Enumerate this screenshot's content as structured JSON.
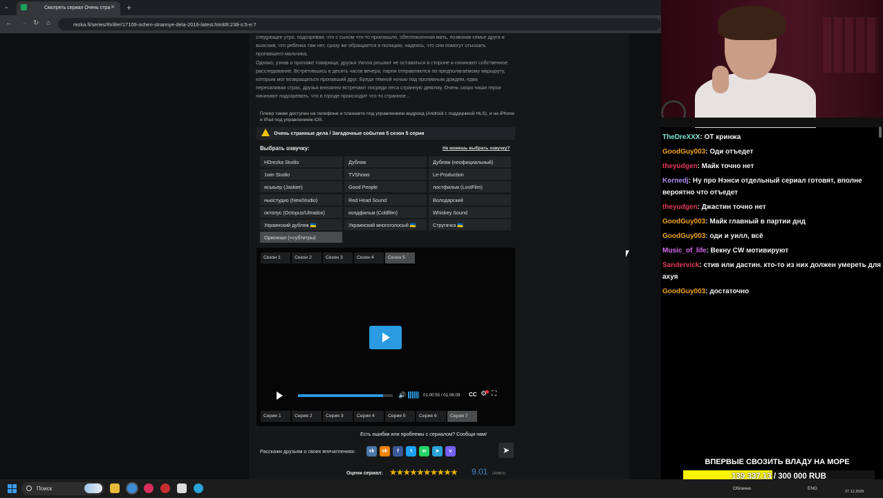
{
  "browser": {
    "tab_title": "Смотреть сериал Очень стра",
    "tab_close": "×",
    "new_tab": "+",
    "tab_menu": "⌄",
    "url": "rezka.fi/series/thriller/17109-ochen-strannye-dela-2016-latest.html#t:238-s:5-e:7",
    "nav_back": "←",
    "nav_forward": "→",
    "nav_reload": "↻",
    "nav_home": "⌂"
  },
  "description": {
    "paragraph1": "следующее утро, подозревая, что с сыном что-то произошло, обеспокоенная мать, позвонив семье друга и выяснив, что ребенка там нет, сразу же обращается в полицию, надеясь, что они помогут отыскать пропавшего мальчика.",
    "paragraph2": "Однако, узнав о пропаже товарища, друзья Уилла решают не оставаться в стороне и начинают собственное расследование. Встретившись в десять часов вечера, парни отправляются по предполагаемому маршруту, которым мог возвращаться пропавший друг. Бредя тёмной ночью под проливным дождем, едва пересиливая страх, друзья внезапно встречают посреди леса странную девочку. Очень скоро наши герои начинают подозревать, что в городе происходит что-то странное..."
  },
  "player_note": "Плеер также доступен на телефоне и планшете под управлением андроид (Android с поддержкой HLS), и на iPhone и iPad под управлением iOS.",
  "episode_title": "Очень странные дела / Загадочные события 5 сезон 5 серия",
  "dubbing": {
    "title": "Выбрать озвучку:",
    "help_link": "Не можешь выбрать озвучку?",
    "options": [
      "HDrezka Studio",
      "Дубляж",
      "Дубляж (неофициальный)",
      "1win Studio",
      "TVShows",
      "Le-Production",
      "яськьер (Jaskier)",
      "Good People",
      "лостфильм (LostFilm)",
      "ньюстудио (NewStudio)",
      "Red Head Sound",
      "Володарский",
      "октопус (Octopus/Ultradox)",
      "колдфильм (Coldfilm)",
      "Whiskey Sound",
      "Украинский дубляж 🇺🇦",
      "Украинский многоголосый 🇺🇦",
      "Стругачка 🇺🇦",
      "Оригинал (+субтитры)"
    ],
    "selected_index": 18
  },
  "seasons": {
    "items": [
      "Сезон 1",
      "Сезон 2",
      "Сезон 3",
      "Сезон 4",
      "Сезон 5"
    ],
    "selected_index": 4
  },
  "player": {
    "time_display": "01:00:55 / 01:06:09",
    "progress_fraction": 0.9,
    "cc_label": "CC",
    "volume_icon": "speaker-icon",
    "volume_symbol": "🔊",
    "settings_symbol": "⚙",
    "fullscreen_symbol": "⛶"
  },
  "episodes": {
    "items": [
      "Серия 1",
      "Серия 2",
      "Серия 3",
      "Серия 4",
      "Серия 5",
      "Серия 6",
      "Серия 7"
    ],
    "selected_index": 6
  },
  "report_text": "Есть ошибки или проблемы с сериалом? Сообщи нам!",
  "share": {
    "label": "Расскажи друзьям о своих впечатлениях:",
    "networks": [
      {
        "name": "vk",
        "glyph": "vk",
        "color": "#4a76a8"
      },
      {
        "name": "ok",
        "glyph": "ok",
        "color": "#ee8208"
      },
      {
        "name": "facebook",
        "glyph": "f",
        "color": "#3b5998"
      },
      {
        "name": "twitter",
        "glyph": "t",
        "color": "#1da1f2"
      },
      {
        "name": "whatsapp",
        "glyph": "w",
        "color": "#25d366"
      },
      {
        "name": "telegram",
        "glyph": "➤",
        "color": "#2aa3d8"
      },
      {
        "name": "viber",
        "glyph": "v",
        "color": "#7360f2"
      }
    ]
  },
  "rating": {
    "label": "Оцени сериал:",
    "stars": "★★★★★★★★★★",
    "value": "9.01",
    "count": "(49853)"
  },
  "chat": {
    "messages": [
      {
        "nick": "TheDreXXX",
        "color": "#7ee8d8",
        "text": ": ОТ кринжа"
      },
      {
        "nick": "GoodGuy003",
        "color": "#f0a21a",
        "text": ": Оди отъедет"
      },
      {
        "nick": "theyudgen",
        "color": "#e33b5a",
        "text": ": Майк точно нет"
      },
      {
        "nick": "Kornedj",
        "color": "#b08ef2",
        "text": ": Ну про Нэнси отдельный сериал готовят, вполне вероятно что отъедет"
      },
      {
        "nick": "theyudgen",
        "color": "#e33b5a",
        "text": ": Джастин точно нет"
      },
      {
        "nick": "GoodGuy003",
        "color": "#f0a21a",
        "text": ": Майк главный в партии днд"
      },
      {
        "nick": "GoodGuy003",
        "color": "#f0a21a",
        "text": ": оди и уилл, всё"
      },
      {
        "nick": "Music_of_life",
        "color": "#d86af2",
        "text": ": Векну CW мотивируют"
      },
      {
        "nick": "Sandervick",
        "color": "#e33b5a",
        "text": ": стив или дастин. кто-то из них должен умереть для ахуя"
      },
      {
        "nick": "GoodGuy003",
        "color": "#f0a21a",
        "text": ": достаточно"
      }
    ]
  },
  "goal": {
    "title": "ВПЕРВЫЕ СВОЗИТЬ ВЛАДУ НА МОРЕ",
    "progress_text": "139 337.13 / 300 000 RUB",
    "fraction": 0.4645
  },
  "taskbar": {
    "search_placeholder": "Поиск",
    "weather": "Облачно",
    "lang": "ENG",
    "date": "27.12.2025"
  }
}
